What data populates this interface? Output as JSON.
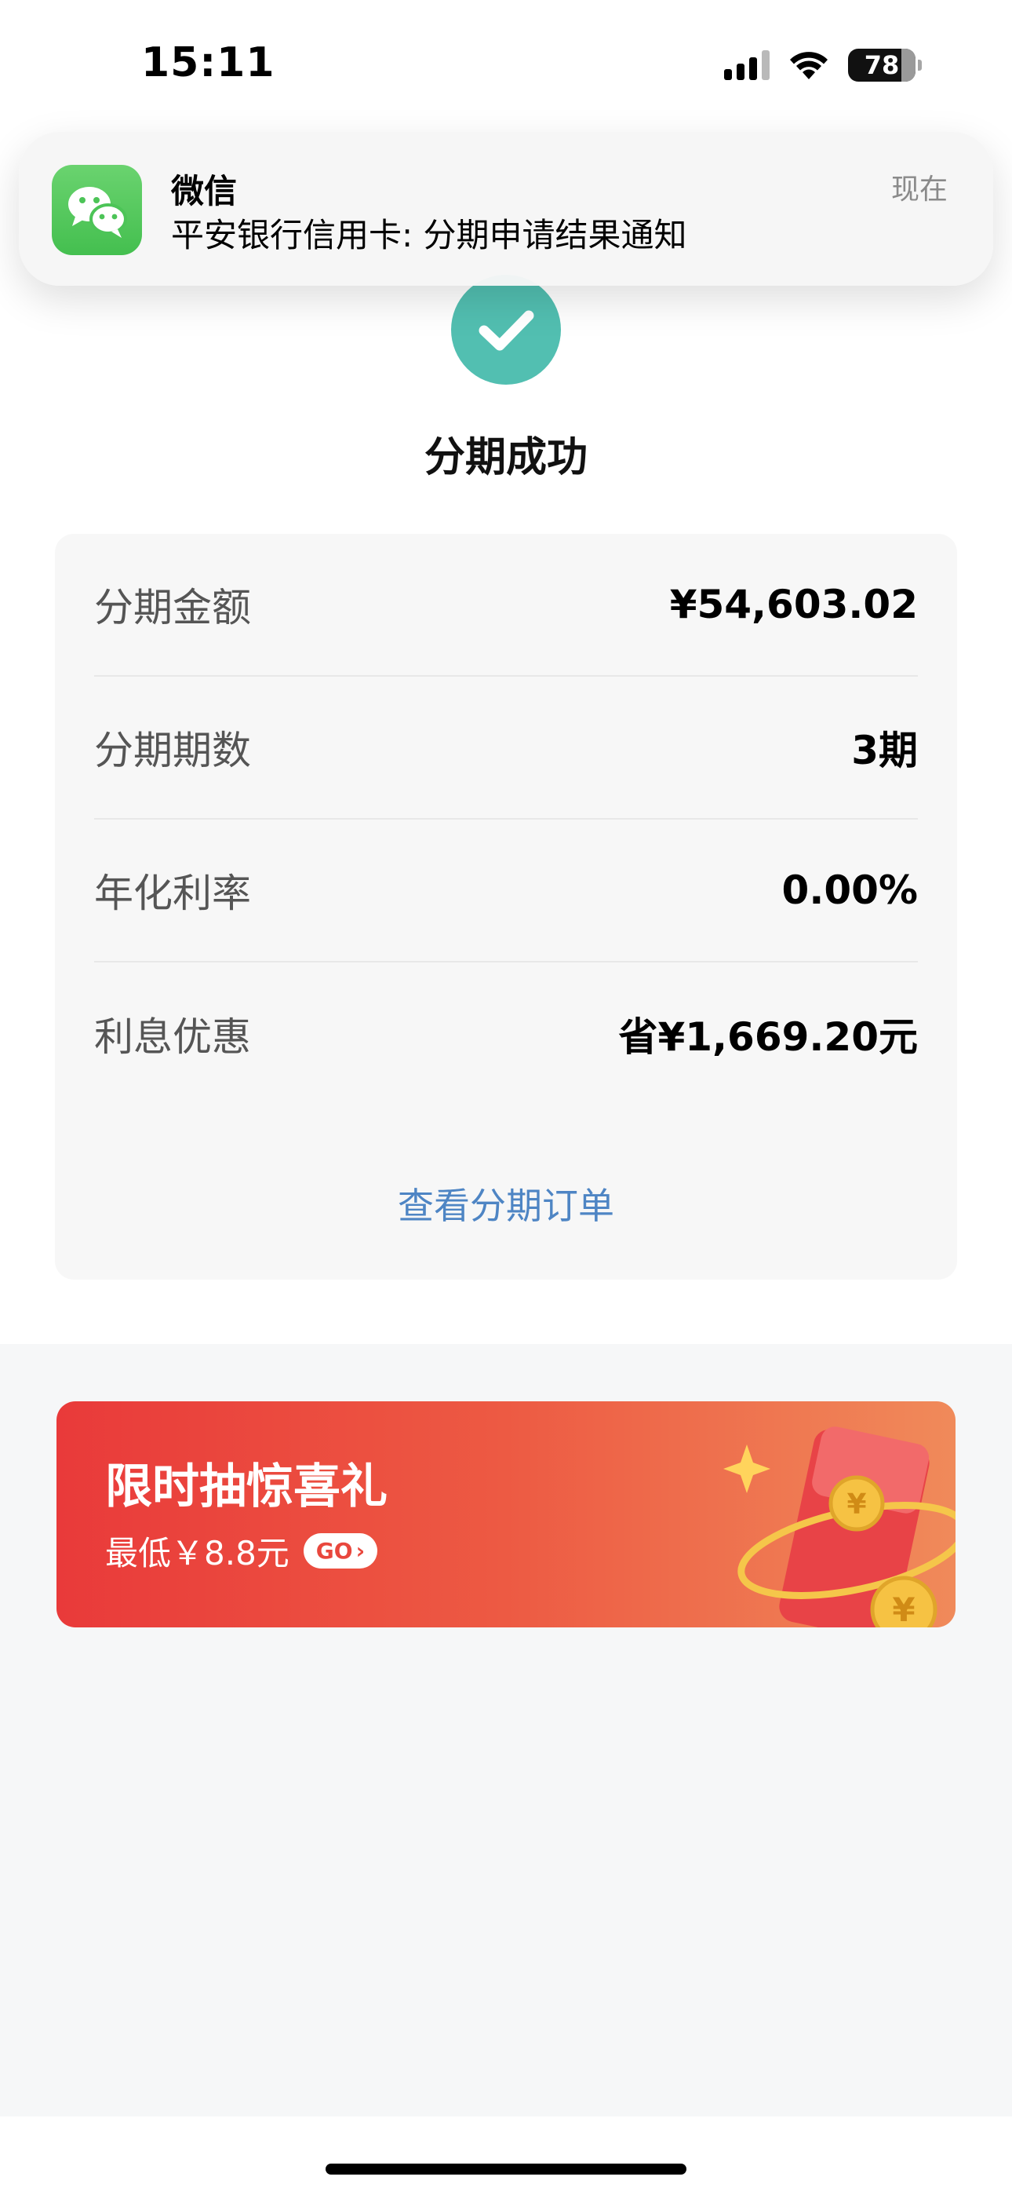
{
  "status_bar": {
    "time": "15:11",
    "battery_level": "78"
  },
  "notification": {
    "app_name": "微信",
    "message": "平安银行信用卡: 分期申请结果通知",
    "time": "现在",
    "app_icon": "wechat-icon"
  },
  "result": {
    "icon": "checkmark-icon",
    "title": "分期成功"
  },
  "details": {
    "rows": [
      {
        "label": "分期金额",
        "value": "¥54,603.02"
      },
      {
        "label": "分期期数",
        "value": "3期"
      },
      {
        "label": "年化利率",
        "value": "0.00%"
      },
      {
        "label": "利息优惠",
        "value": "省¥1,669.20元"
      }
    ],
    "link_label": "查看分期订单"
  },
  "promo": {
    "title": "限时抽惊喜礼",
    "subtitle": "最低￥8.8元",
    "go_label": "GO",
    "art_icon": "red-envelope-icon"
  },
  "colors": {
    "success": "#52bfb1",
    "link": "#4e85c4",
    "promo_start": "#e93a3a",
    "promo_end": "#f08a5a",
    "wechat_green": "#4cc457"
  }
}
